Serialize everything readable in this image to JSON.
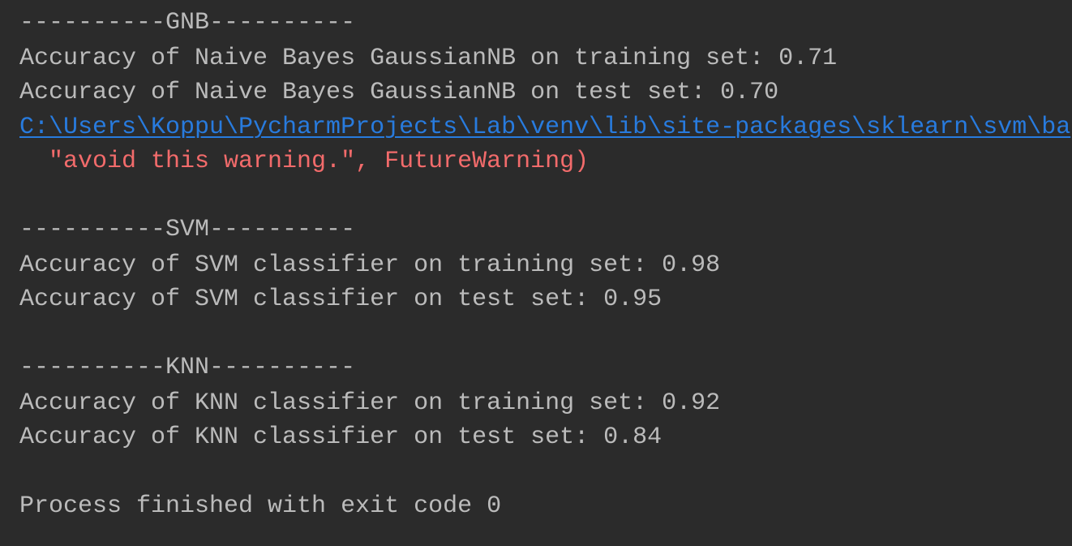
{
  "console": {
    "gnb": {
      "header": "----------GNB----------",
      "train": "Accuracy of Naive Bayes GaussianNB on training set: 0.71",
      "test": "Accuracy of Naive Bayes GaussianNB on test set: 0.70"
    },
    "warning": {
      "link": "C:\\Users\\Koppu\\PycharmProjects\\Lab\\venv\\lib\\site-packages\\sklearn\\svm\\ba",
      "message": "  \"avoid this warning.\", FutureWarning)"
    },
    "svm": {
      "header": "----------SVM----------",
      "train": "Accuracy of SVM classifier on training set: 0.98",
      "test": "Accuracy of SVM classifier on test set: 0.95"
    },
    "knn": {
      "header": "----------KNN----------",
      "train": "Accuracy of KNN classifier on training set: 0.92",
      "test": "Accuracy of KNN classifier on test set: 0.84"
    },
    "exit": "Process finished with exit code 0"
  },
  "colors": {
    "background": "#2b2b2b",
    "text": "#bbbbbb",
    "link": "#287bde",
    "warning": "#f26b6b"
  }
}
